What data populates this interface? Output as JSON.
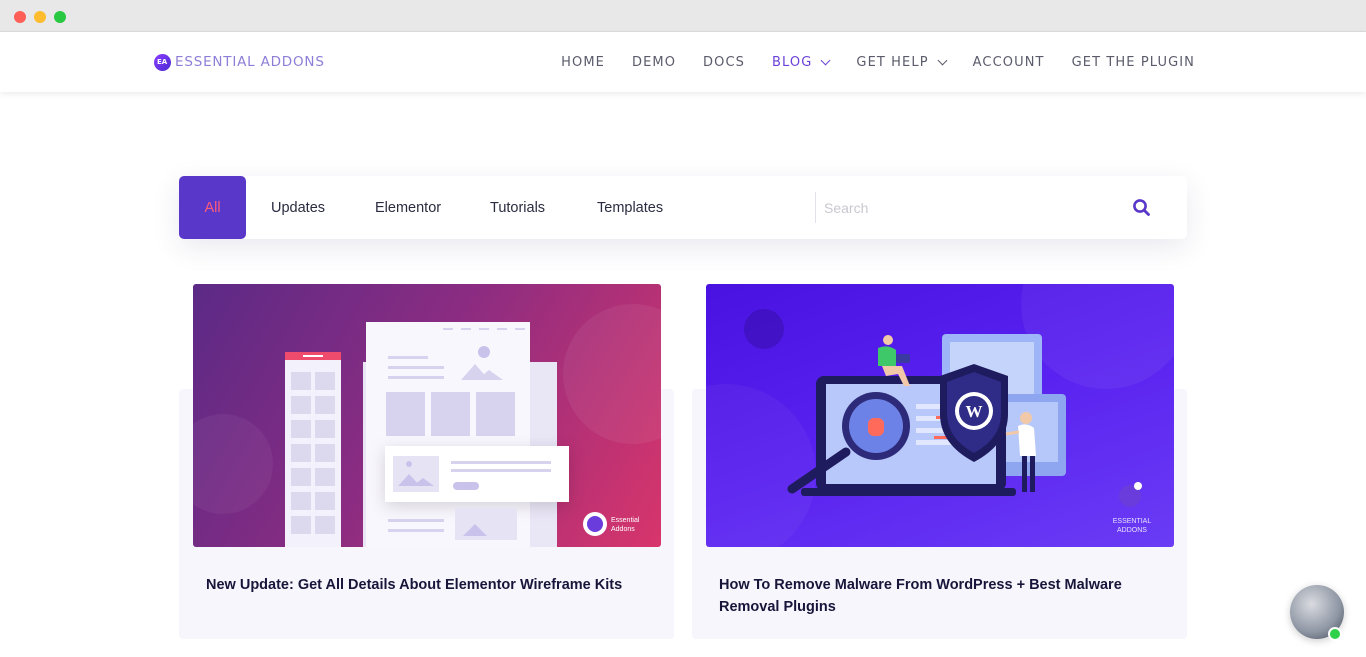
{
  "header": {
    "logo_text": "ESSENTIAL ADDONS",
    "nav": [
      {
        "label": "HOME"
      },
      {
        "label": "DEMO"
      },
      {
        "label": "DOCS"
      },
      {
        "label": "BLOG"
      },
      {
        "label": "GET HELP"
      },
      {
        "label": "ACCOUNT"
      },
      {
        "label": "GET THE PLUGIN"
      }
    ]
  },
  "filter": {
    "tabs": [
      {
        "label": "All"
      },
      {
        "label": "Updates"
      },
      {
        "label": "Elementor"
      },
      {
        "label": "Tutorials"
      },
      {
        "label": "Templates"
      }
    ],
    "search_placeholder": "Search"
  },
  "posts": [
    {
      "title": "New Update: Get All Details About Elementor Wireframe Kits",
      "badge_line1": "Essential",
      "badge_line2": "Addons"
    },
    {
      "title": "How To Remove Malware From WordPress + Best Malware Removal Plugins",
      "badge_line1": "ESSENTIAL",
      "badge_line2": "ADDONS"
    }
  ],
  "colors": {
    "accent": "#5937c9",
    "active_nav": "#6b42d8",
    "active_tab_text": "#ff5c7a"
  }
}
